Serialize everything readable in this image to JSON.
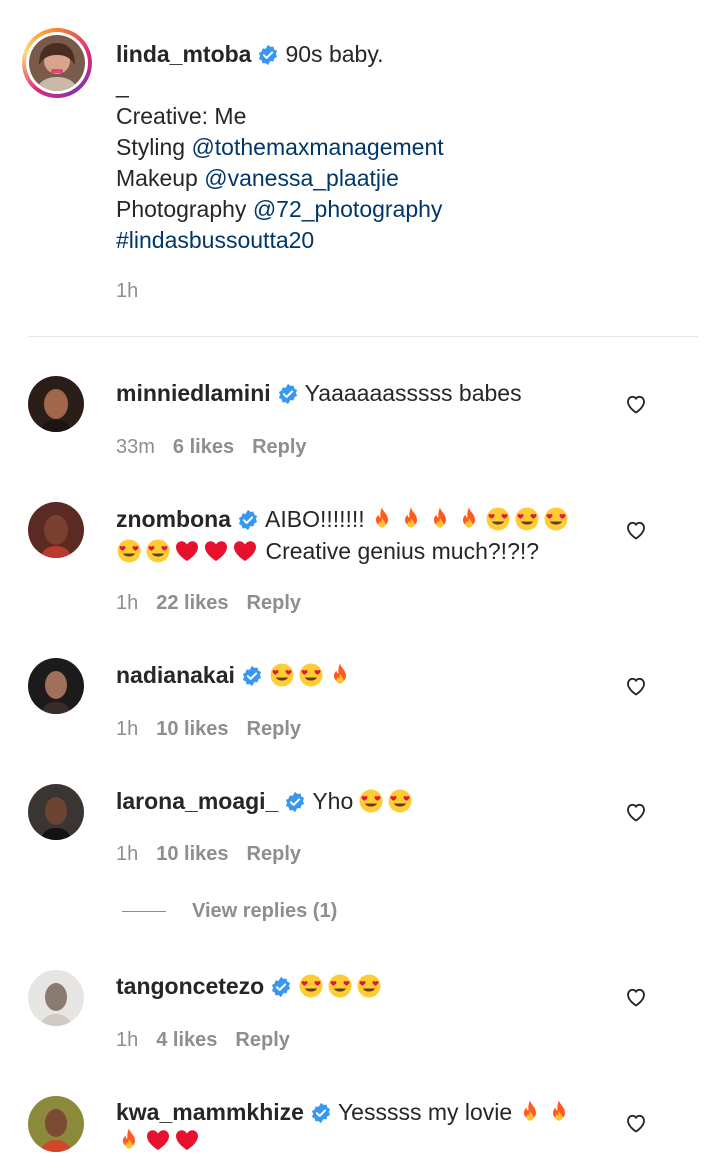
{
  "post": {
    "username": "linda_mtoba",
    "caption_first": "90s baby.",
    "caption_sep": "_",
    "creative_line": "Creative: Me",
    "styling_label": "Styling",
    "styling_handle": "@tothemaxmanagement",
    "makeup_label": "Makeup",
    "makeup_handle": "@vanessa_plaatjie",
    "photo_label": "Photography",
    "photo_handle": "@72_photography",
    "hashtag": "#lindasbussoutta20",
    "time": "1h"
  },
  "comments": [
    {
      "username": "minniedlamini",
      "text": "Yaaaaaasssss babes",
      "time": "33m",
      "likes": "6 likes",
      "reply": "Reply"
    },
    {
      "username": "znombona",
      "text_a": "AIBO!!!!!!!",
      "text_b": "Creative genius much?!?!?",
      "time": "1h",
      "likes": "22 likes",
      "reply": "Reply"
    },
    {
      "username": "nadianakai",
      "time": "1h",
      "likes": "10 likes",
      "reply": "Reply"
    },
    {
      "username": "larona_moagi_",
      "text": "Yho",
      "time": "1h",
      "likes": "10 likes",
      "reply": "Reply"
    },
    {
      "username": "tangoncetezo",
      "time": "1h",
      "likes": "4 likes",
      "reply": "Reply"
    },
    {
      "username": "kwa_mammkhize",
      "text": "Yesssss my lovie"
    }
  ],
  "view_replies": "View replies (1)",
  "colors": {
    "verified": "#3897f0",
    "link": "#00376b",
    "muted": "#8e8e8e",
    "text": "#262626"
  },
  "icons": [
    "verified-badge-icon",
    "heart-outline-icon",
    "fire-emoji",
    "heart-eyes-emoji",
    "red-heart-emoji"
  ]
}
